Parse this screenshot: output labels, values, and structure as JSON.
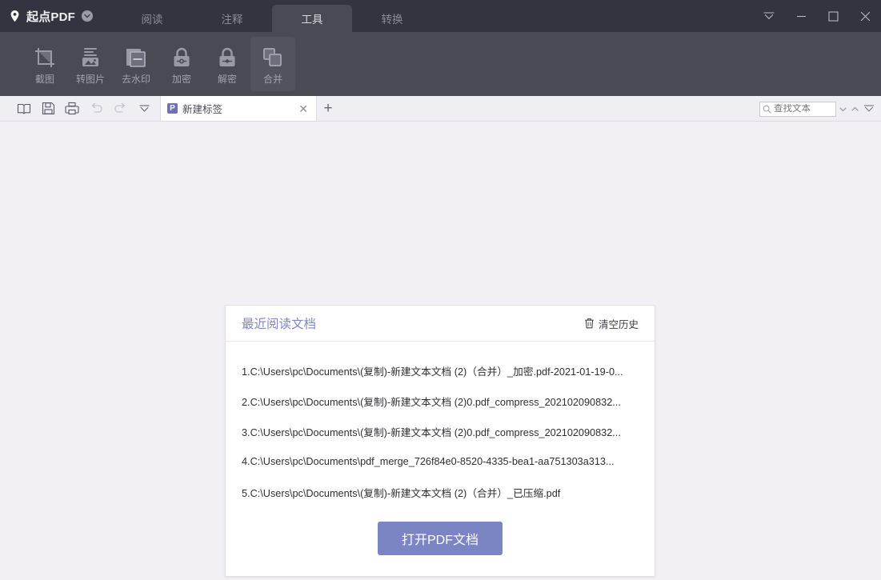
{
  "titlebar": {
    "brand": "起点PDF",
    "brand_icon": "location-pin-icon",
    "brand_caret_icon": "chevron-down-circle-icon",
    "tabs": [
      {
        "label": "阅读",
        "active": false
      },
      {
        "label": "注释",
        "active": false
      },
      {
        "label": "工具",
        "active": true
      },
      {
        "label": "转换",
        "active": false
      }
    ],
    "window_controls": [
      {
        "name": "collapse-ribbon-button",
        "icon": "double-chevron-down-icon"
      },
      {
        "name": "minimize-button",
        "icon": "minimize-icon"
      },
      {
        "name": "maximize-button",
        "icon": "maximize-icon"
      },
      {
        "name": "close-button",
        "icon": "close-icon"
      }
    ]
  },
  "ribbon": {
    "tools": [
      {
        "label": "截图",
        "icon": "crop-icon",
        "active": false
      },
      {
        "label": "转图片",
        "icon": "image-convert-icon",
        "active": false
      },
      {
        "label": "去水印",
        "icon": "watermark-remove-icon",
        "active": false
      },
      {
        "label": "加密",
        "icon": "lock-closed-icon",
        "active": false
      },
      {
        "label": "解密",
        "icon": "lock-open-icon",
        "active": false
      },
      {
        "label": "合并",
        "icon": "merge-icon",
        "active": true
      }
    ]
  },
  "subbar": {
    "quick_icons": [
      {
        "name": "open-book-icon",
        "disabled": false
      },
      {
        "name": "save-icon",
        "disabled": false
      },
      {
        "name": "print-icon",
        "disabled": false
      },
      {
        "name": "undo-icon",
        "disabled": true
      },
      {
        "name": "redo-icon",
        "disabled": true
      },
      {
        "name": "chevron-down-icon",
        "disabled": false
      }
    ],
    "document_tab": {
      "badge": "P",
      "label": "新建标签",
      "close_label": "✕"
    },
    "add_tab_label": "+",
    "search": {
      "placeholder": "查找文本",
      "value": "",
      "icon": "search-icon",
      "prev_icon": "caret-down-icon",
      "next_icon": "caret-up-icon",
      "more_icon": "double-chevron-down-icon"
    }
  },
  "card": {
    "title": "最近阅读文档",
    "clear_history": {
      "label": "清空历史",
      "icon": "trash-icon"
    },
    "files": [
      "1.C:\\Users\\pc\\Documents\\(复制)-新建文本文档 (2)（合并）_加密.pdf-2021-01-19-0...",
      "2.C:\\Users\\pc\\Documents\\(复制)-新建文本文档 (2)0.pdf_compress_202102090832...",
      "3.C:\\Users\\pc\\Documents\\(复制)-新建文本文档 (2)0.pdf_compress_202102090832...",
      "4.C:\\Users\\pc\\Documents\\pdf_merge_726f84e0-8520-4335-bea1-aa751303a313...",
      "5.C:\\Users\\pc\\Documents\\(复制)-新建文本文档 (2)（合并）_已压缩.pdf"
    ],
    "open_button": "打开PDF文档"
  },
  "colors": {
    "titlebar_bg": "#343440",
    "ribbon_bg": "#4a4a55",
    "ribbon_active": "#53535f",
    "canvas_bg": "#f2f0f4",
    "accent_purple": "#7f86c4",
    "button_purple": "#7b85c4",
    "tab_badge": "#6f6fb4"
  }
}
